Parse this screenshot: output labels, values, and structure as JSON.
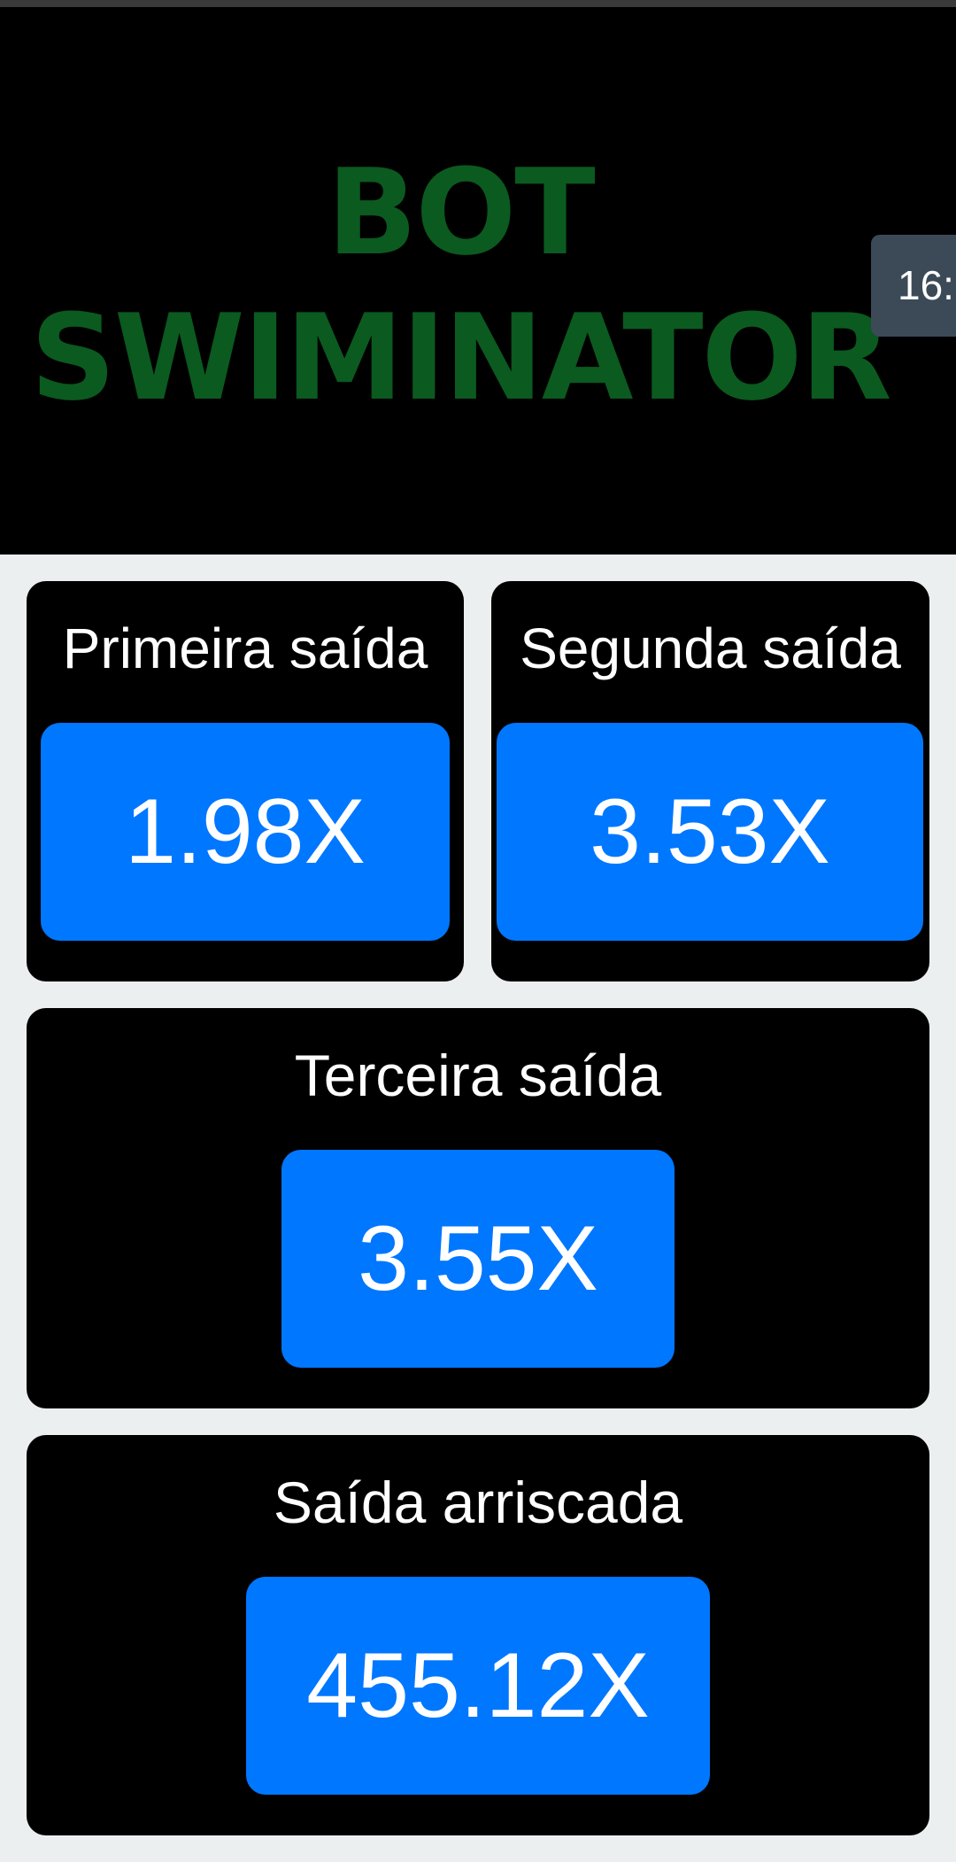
{
  "header": {
    "title_line1": "BOT",
    "title_line2": "SWIMINATOR",
    "time": "16:"
  },
  "cards": [
    {
      "label": "Primeira saída",
      "value": "1.98X"
    },
    {
      "label": "Segunda saída",
      "value": "3.53X"
    },
    {
      "label": "Terceira saída",
      "value": "3.55X"
    },
    {
      "label": "Saída arriscada",
      "value": "455.12X"
    }
  ],
  "colors": {
    "title": "#0b5a1f",
    "button": "#0077ff",
    "card": "#000000",
    "page_background": "#eceff0"
  }
}
